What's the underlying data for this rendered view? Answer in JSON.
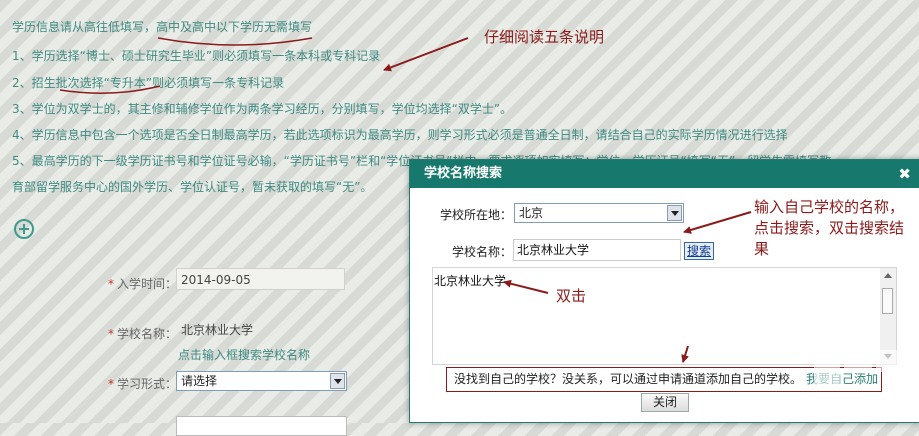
{
  "instructions": {
    "title_part1": "学历信息请从高往低填写，",
    "title_part2": "高中及高中以下学历无需填写",
    "items": [
      "1、学历选择“博士、硕士研究生毕业”则必须填写一条本科或专科记录",
      "2、招生批次选择“专升本”则必须填写一条专科记录",
      "3、学位为双学士的，其主修和辅修学位作为两条学习经历，分别填写，学位均选择“双学士”。",
      "4、学历信息中包含一个选项是否全日制最高学历，若此选项标识为最高学历，则学习形式必须是普通全日制，请结合自己的实际学历情况进行选择",
      "5、最高学历的下一级学历证书号和学位证号必输，“学历证书号”栏和“学位证书号”栏中，要求逐项如实填写；学位、学历证号“填写“无”。留学生需填写教",
      "育部留学服务中心的国外学历、学位认证号，暂未获取的填写“无”。"
    ]
  },
  "form": {
    "enroll_label": "入学时间：",
    "enroll_value": "2014-09-05",
    "school_label": "学校名称：",
    "school_value": "北京林业大学",
    "school_hint": "点击输入框搜索学校名称",
    "mode_label": "学习形式：",
    "mode_value": "请选择",
    "required_mark": "*"
  },
  "modal": {
    "title": "学校名称搜索",
    "close_glyph": "✖",
    "location_label": "学校所在地：",
    "location_value": "北京",
    "name_label": "学校名称：",
    "name_value": "北京林业大学",
    "search_label": "搜索",
    "results": [
      "北京林业大学"
    ],
    "notice_text": "没找到自己的学校？没关系，可以通过申请通道添加自己的学校。",
    "notice_link": "我要自己添加",
    "close_label": "关闭"
  },
  "annotations": {
    "read_five": "仔细阅读五条说明",
    "enter_school_1": "输入自己学校的名称，",
    "enter_school_2": "点击搜索，双击搜索结",
    "enter_school_3": "果",
    "double_click": "双击"
  },
  "watermark": {
    "text": "PHPCMS.CN"
  },
  "colors": {
    "accent": "#17786d",
    "note_text": "#3e8a82",
    "annotation": "#8b1a1a"
  }
}
